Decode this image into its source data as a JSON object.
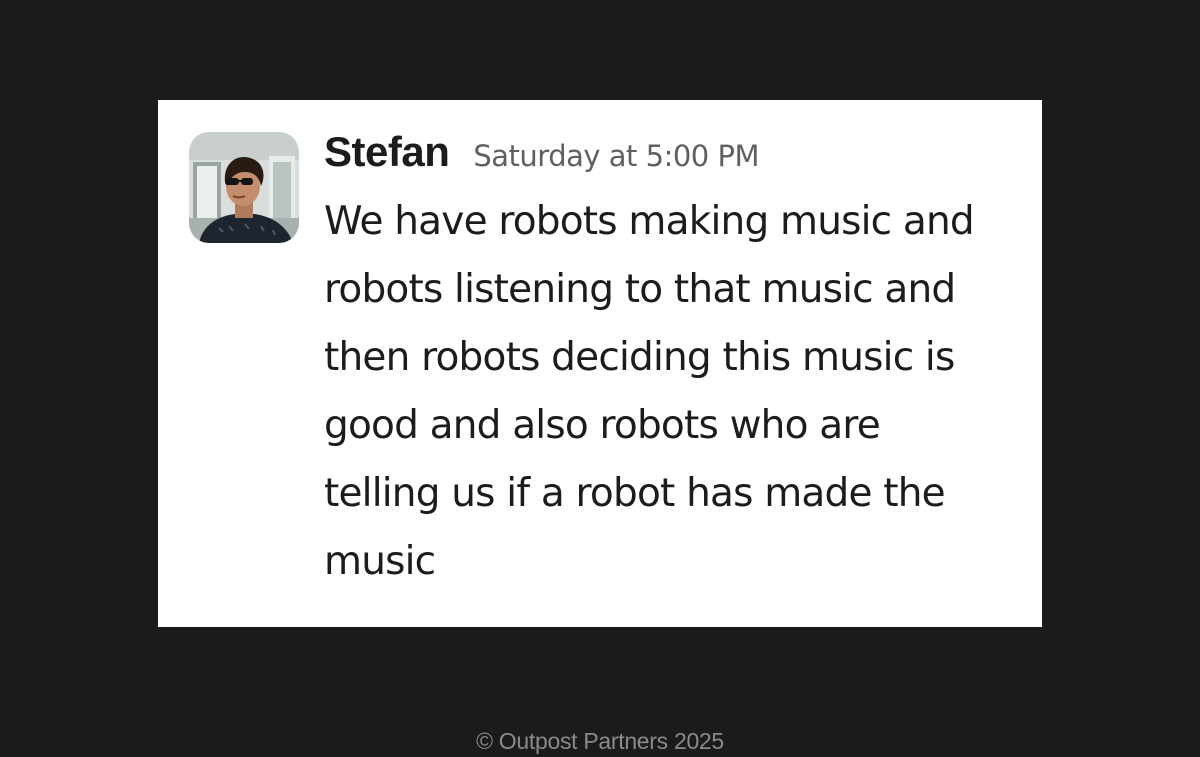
{
  "message": {
    "author": "Stefan",
    "timestamp": "Saturday at 5:00 PM",
    "avatar_icon": "user-avatar-photo",
    "body_lines": [
      "We have robots making music and",
      "robots listening to that music and",
      "then robots deciding this music is",
      "good and also robots who are",
      "telling us if a robot has made the",
      "music"
    ]
  },
  "footer": {
    "copyright": "© Outpost Partners 2025"
  },
  "colors": {
    "background": "#1b1b1b",
    "card": "#ffffff",
    "text_primary": "#1d1c1d",
    "text_secondary": "#616061",
    "footer_text": "#8a8a8a"
  }
}
